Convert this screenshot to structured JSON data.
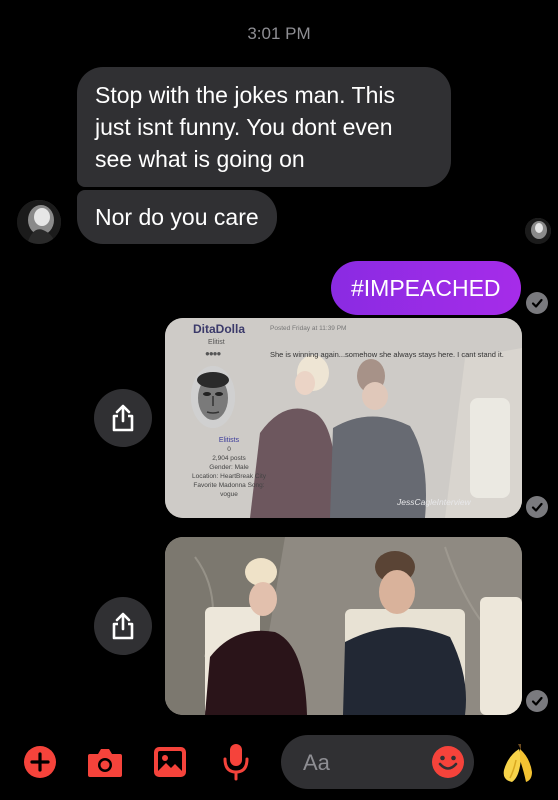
{
  "status": {
    "time": "3:01 PM"
  },
  "messages": {
    "incoming_1": "Stop with the jokes man. This just isnt funny. You dont even see what is going on",
    "incoming_2": "Nor do you care",
    "outgoing_1": "#IMPEACHED"
  },
  "forum_screenshot": {
    "username": "DitaDolla",
    "rank": "Elitist",
    "rank_dots": "●●●●",
    "posted": "Posted Friday at 11:39 PM",
    "message": "She is winning again...somehow she always stays here. I cant stand it.",
    "meta_signature": "Elitists",
    "meta_lines": [
      "0",
      "2,904 posts",
      "Gender: Male",
      "Location: HeartBreak City",
      "Favorite Madonna Song:",
      "vogue"
    ],
    "watermark": "JessCagleInterview"
  },
  "composer": {
    "placeholder": "Aa"
  },
  "toolbar": {
    "icons": [
      "plus-icon",
      "camera-icon",
      "gallery-icon",
      "microphone-icon",
      "emoji-icon",
      "banana-emoji-icon"
    ]
  },
  "colors": {
    "accent": "#f5433b",
    "outgoing_bubble": "#9a2ce6",
    "incoming_bubble": "#303033",
    "background": "#000000"
  }
}
